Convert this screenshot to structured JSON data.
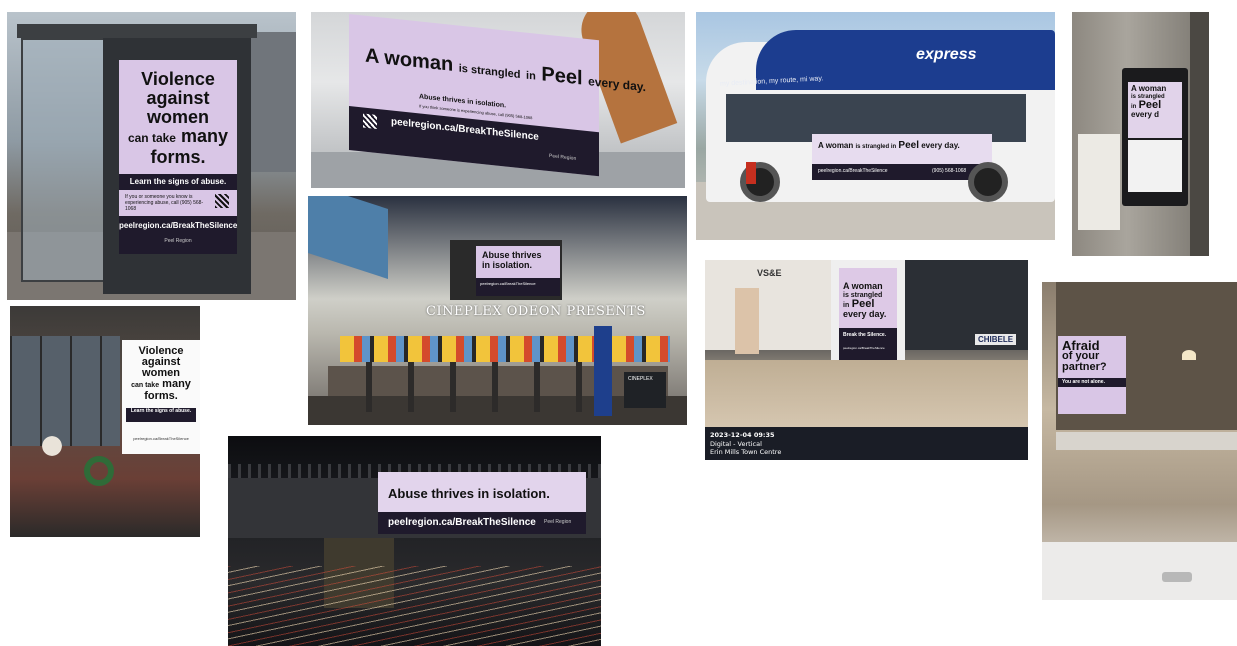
{
  "photos": {
    "bus_shelter": {
      "headline_1": "Violence",
      "headline_2": "against",
      "headline_3": "women",
      "headline_4a": "can take",
      "headline_4b": "many",
      "headline_5": "forms.",
      "sub": "Learn the signs of abuse.",
      "help": "If you or someone you know is experiencing abuse, call (905) 568-1068",
      "url": "peelregion.ca/BreakTheSilence",
      "logo": "Peel Region"
    },
    "transit_interior": {
      "headline_a": "A woman",
      "headline_b": "is strangled",
      "headline_c": "in",
      "headline_d": "Peel",
      "headline_e": "every day.",
      "sub": "Abuse thrives in isolation.",
      "fine": "If you think someone is experiencing abuse, call (905) 568-1068",
      "url": "peelregion.ca/BreakTheSilence",
      "logo": "Peel Region"
    },
    "bus": {
      "brand": "express",
      "route_sign": "my destination, my route, mi way.",
      "headline_a": "A woman",
      "headline_b": "is strangled in",
      "headline_c": "Peel",
      "headline_d": "every day.",
      "url": "peelregion.ca/BreakTheSilence",
      "phone": "(905) 568-1068"
    },
    "elevator": {
      "headline_a": "A woman",
      "headline_b": "is strangled",
      "headline_c": "in",
      "headline_d": "Peel",
      "headline_e": "every d"
    },
    "storefront": {
      "headline_1": "Violence",
      "headline_2": "against",
      "headline_3": "women",
      "headline_4a": "can take",
      "headline_4b": "many",
      "headline_5": "forms.",
      "sub": "Learn the signs of abuse.",
      "url": "peelregion.ca/BreakTheSilence"
    },
    "cinema": {
      "billboard_1": "Abuse thrives",
      "billboard_2": "in isolation.",
      "url": "peelregion.ca/BreakTheSilence",
      "sign": "CINEPLEX ODEON PRESENTS",
      "kiosk": "CINEPLEX"
    },
    "mall": {
      "store_sign": "VS&E",
      "headline_a": "A woman",
      "headline_b": "is strangled",
      "headline_c": "in",
      "headline_d": "Peel",
      "headline_e": "every day.",
      "sub": "Break the Silence.",
      "url": "peelregion.ca/BreakTheSilence",
      "side_sign": "CHIBELE",
      "caption_1": "2023-12-04 09:35",
      "caption_2": "Digital - Vertical",
      "caption_3": "Erin Mills Town Centre"
    },
    "washroom": {
      "headline_1": "Afraid",
      "headline_2": "of your",
      "headline_3": "partner?",
      "sub": "You are not alone."
    },
    "overpass": {
      "headline": "Abuse thrives in isolation.",
      "url": "peelregion.ca/BreakTheSilence",
      "logo": "Peel Region"
    }
  },
  "colors": {
    "ad_lavender": "#d9c6e6",
    "ad_dark": "#1f1a2c",
    "bus_blue": "#1c3d8f"
  }
}
